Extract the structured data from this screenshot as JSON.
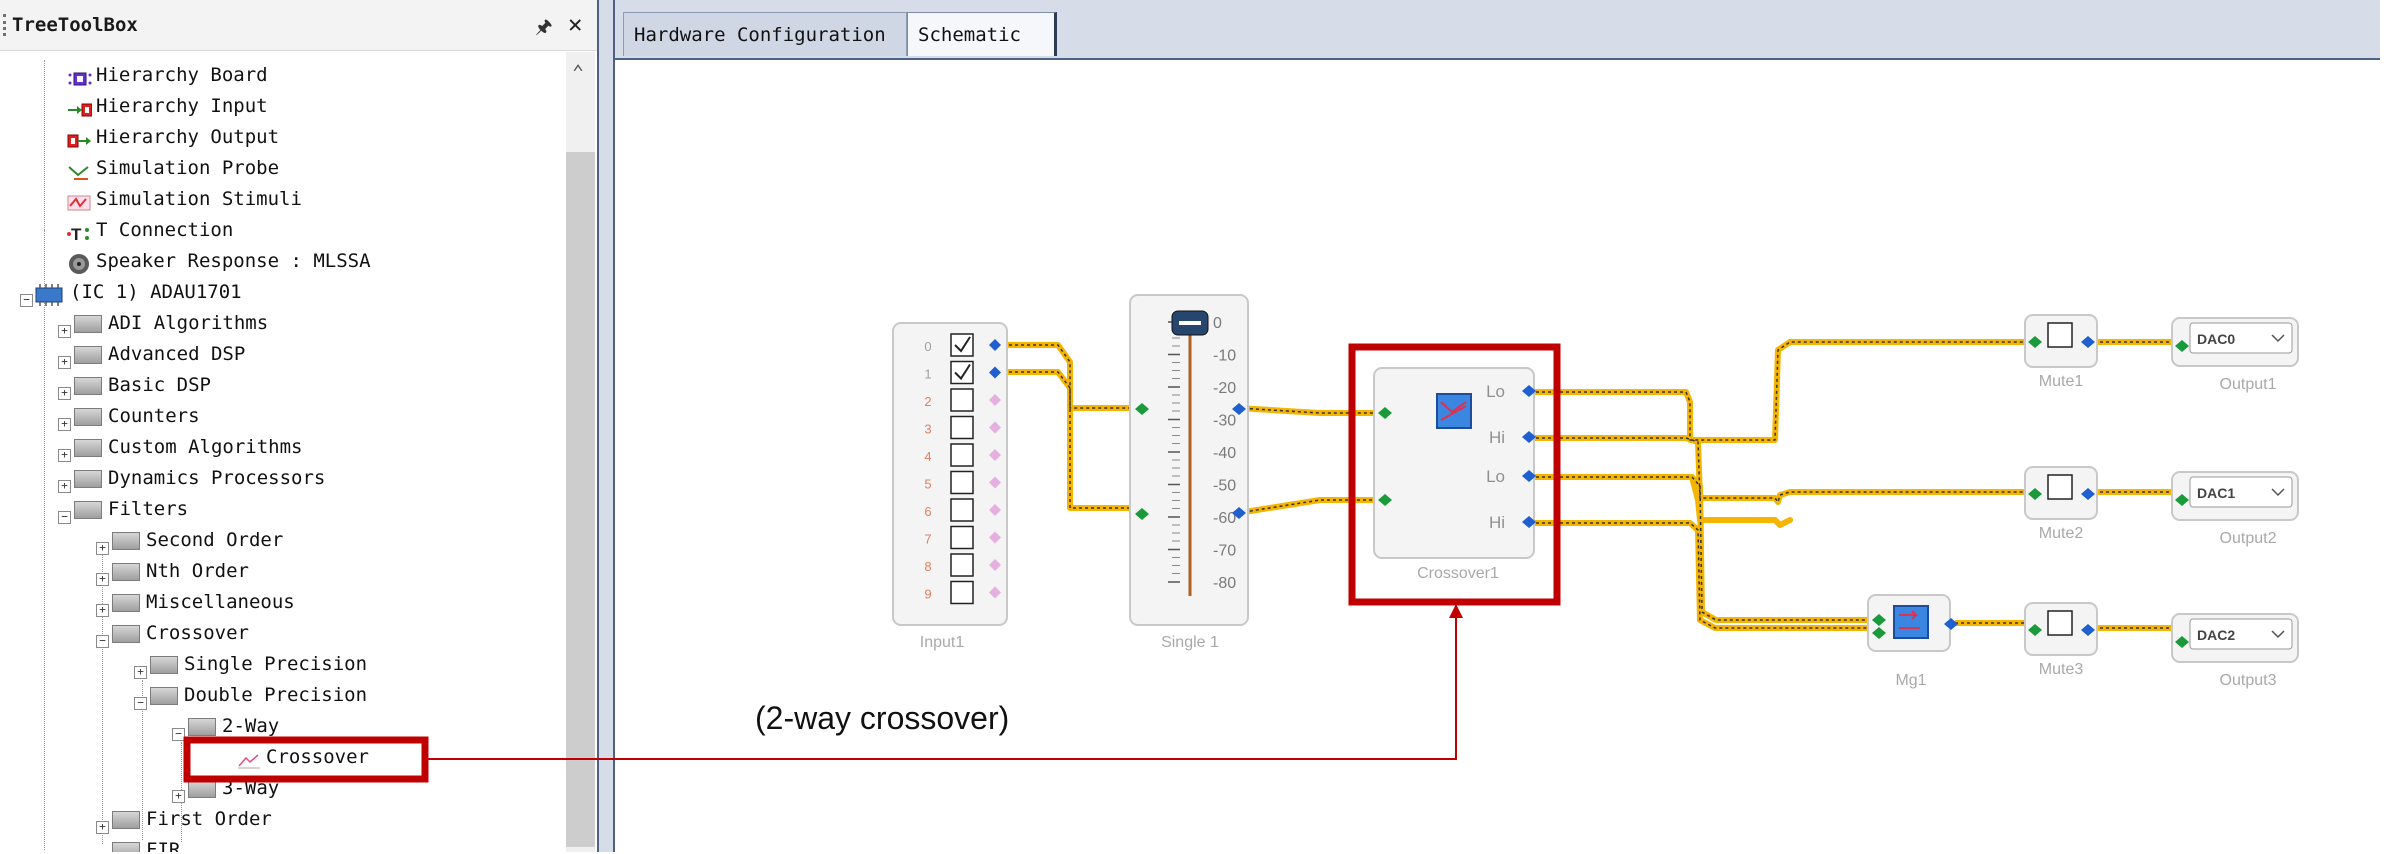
{
  "toolbox": {
    "title": "TreeToolBox",
    "pin_glyph": "ℹ",
    "close_glyph": "✕"
  },
  "tree": {
    "hier_board": "Hierarchy Board",
    "hier_input": "Hierarchy Input",
    "hier_output": "Hierarchy Output",
    "sim_probe": "Simulation Probe",
    "sim_stimuli": "Simulation Stimuli",
    "t_connection": "T Connection",
    "speaker_response": "Speaker Response : MLSSA",
    "ic1": "(IC 1) ADAU1701",
    "adi_algorithms": "ADI Algorithms",
    "advanced_dsp": "Advanced DSP",
    "basic_dsp": "Basic DSP",
    "counters": "Counters",
    "custom_algorithms": "Custom Algorithms",
    "dynamics_processors": "Dynamics Processors",
    "filters": "Filters",
    "second_order": "Second Order",
    "nth_order": "Nth Order",
    "miscellaneous": "Miscellaneous",
    "crossover": "Crossover",
    "single_precision": "Single Precision",
    "double_precision": "Double Precision",
    "two_way": "2-Way",
    "crossover_item": "Crossover",
    "three_way": "3-Way",
    "first_order": "First Order",
    "fir": "FIR"
  },
  "tabs": {
    "hardware": "Hardware Configuration",
    "schematic": "Schematic"
  },
  "schematic": {
    "input_channels": [
      "0",
      "1",
      "2",
      "3",
      "4",
      "5",
      "6",
      "7",
      "8",
      "9"
    ],
    "input_checked": [
      true,
      true,
      false,
      false,
      false,
      false,
      false,
      false,
      false,
      false
    ],
    "input_label": "Input1",
    "single_ticks": [
      "0",
      "-10",
      "-20",
      "-30",
      "-40",
      "-50",
      "-60",
      "-70",
      "-80"
    ],
    "single_label": "Single 1",
    "crossover_ports": [
      "Lo",
      "Hi",
      "Lo",
      "Hi"
    ],
    "crossover_label": "Crossover1",
    "mute_labels": [
      "Mute1",
      "Mute2",
      "Mute3"
    ],
    "mg_label": "Mg1",
    "dac_values": [
      "DAC0",
      "DAC1",
      "DAC2"
    ],
    "output_labels": [
      "Output1",
      "Output2",
      "Output3"
    ]
  },
  "annotation": {
    "text": "(2-way crossover)"
  },
  "colors": {
    "highlight": "#c00000",
    "wire": "#f5b400",
    "port_in": "#1a9a3a",
    "port_out": "#1f5fd0"
  }
}
